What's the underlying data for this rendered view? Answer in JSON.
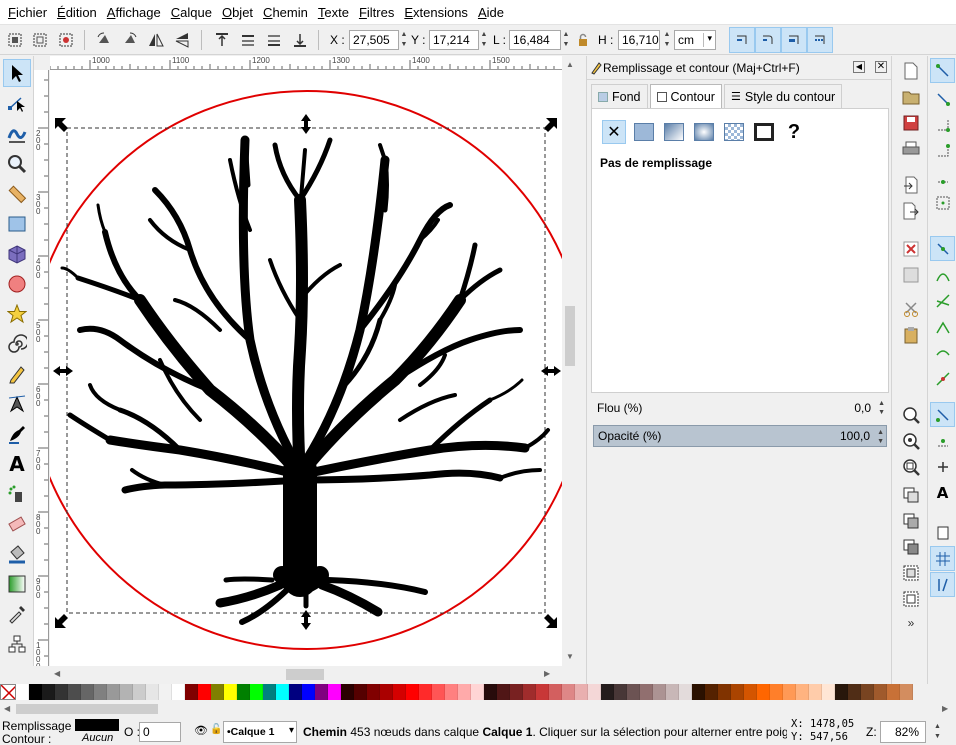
{
  "menu": [
    "Fichier",
    "Édition",
    "Affichage",
    "Calque",
    "Objet",
    "Chemin",
    "Texte",
    "Filtres",
    "Extensions",
    "Aide"
  ],
  "coords": {
    "x_label": "X :",
    "x_value": "27,505",
    "y_label": "Y :",
    "y_value": "17,214",
    "w_label": "L :",
    "w_value": "16,484",
    "h_label": "H :",
    "h_value": "16,710",
    "unit": "cm"
  },
  "ruler": {
    "h_ticks": [
      "1000",
      "1100",
      "1200",
      "1300",
      "1400",
      "1500"
    ],
    "v_ticks": [
      "200",
      "300",
      "400",
      "500",
      "600",
      "700",
      "800",
      "900",
      "1000"
    ]
  },
  "dialog": {
    "title": "Remplissage et contour (Maj+Ctrl+F)",
    "tabs": [
      "Fond",
      "Contour",
      "Style du contour"
    ],
    "fill_status": "Pas de remplissage",
    "blur_label": "Flou (%)",
    "blur_value": "0,0",
    "opacity_label": "Opacité (%)",
    "opacity_value": "100,0"
  },
  "status": {
    "fill_label": "Remplissage :",
    "stroke_label": "Contour :",
    "stroke_value": "Aucun",
    "opacity_label": "O :",
    "opacity_value": "0",
    "layer": "•Calque 1",
    "msg_bold1": "Chemin",
    "msg1": " 453 nœuds dans calque ",
    "msg_bold2": "Calque 1",
    "msg2": ". Cliquer sur la sélection pour alterner entre poignées",
    "cursor_x": "X: 1478,05",
    "cursor_y": "Y:  547,56",
    "zoom_label": "Z:",
    "zoom_value": "82%"
  },
  "colors": {
    "accent": "#cce4f7",
    "circle_stroke": "#e00000",
    "tree": "#000000"
  },
  "palette": [
    "#ffffff",
    "#000000",
    "#1a1a1a",
    "#333333",
    "#4d4d4d",
    "#666666",
    "#808080",
    "#999999",
    "#b3b3b3",
    "#cccccc",
    "#e6e6e6",
    "#f2f2f2",
    "#ffffff",
    "#800000",
    "#ff0000",
    "#808000",
    "#ffff00",
    "#008000",
    "#00ff00",
    "#008080",
    "#00ffff",
    "#000080",
    "#0000ff",
    "#800080",
    "#ff00ff",
    "#2b0000",
    "#550000",
    "#800000",
    "#aa0000",
    "#d40000",
    "#ff0000",
    "#ff2a2a",
    "#ff5555",
    "#ff8080",
    "#ffaaaa",
    "#ffd5d5",
    "#280b0b",
    "#501616",
    "#782121",
    "#a02c2c",
    "#c83737",
    "#d35f5f",
    "#de8787",
    "#e9afaf",
    "#f4d7d7",
    "#241c1c",
    "#483737",
    "#6c5353",
    "#916f6f",
    "#ac9393",
    "#c8b7b7",
    "#e3dbdb",
    "#2b1100",
    "#552200",
    "#803300",
    "#aa4400",
    "#d45500",
    "#ff6600",
    "#ff7f2a",
    "#ff9955",
    "#ffb380",
    "#ffccaa",
    "#ffe6d5",
    "#28170b",
    "#502d16",
    "#784421",
    "#a05a2c",
    "#c87137",
    "#d38d5f"
  ]
}
